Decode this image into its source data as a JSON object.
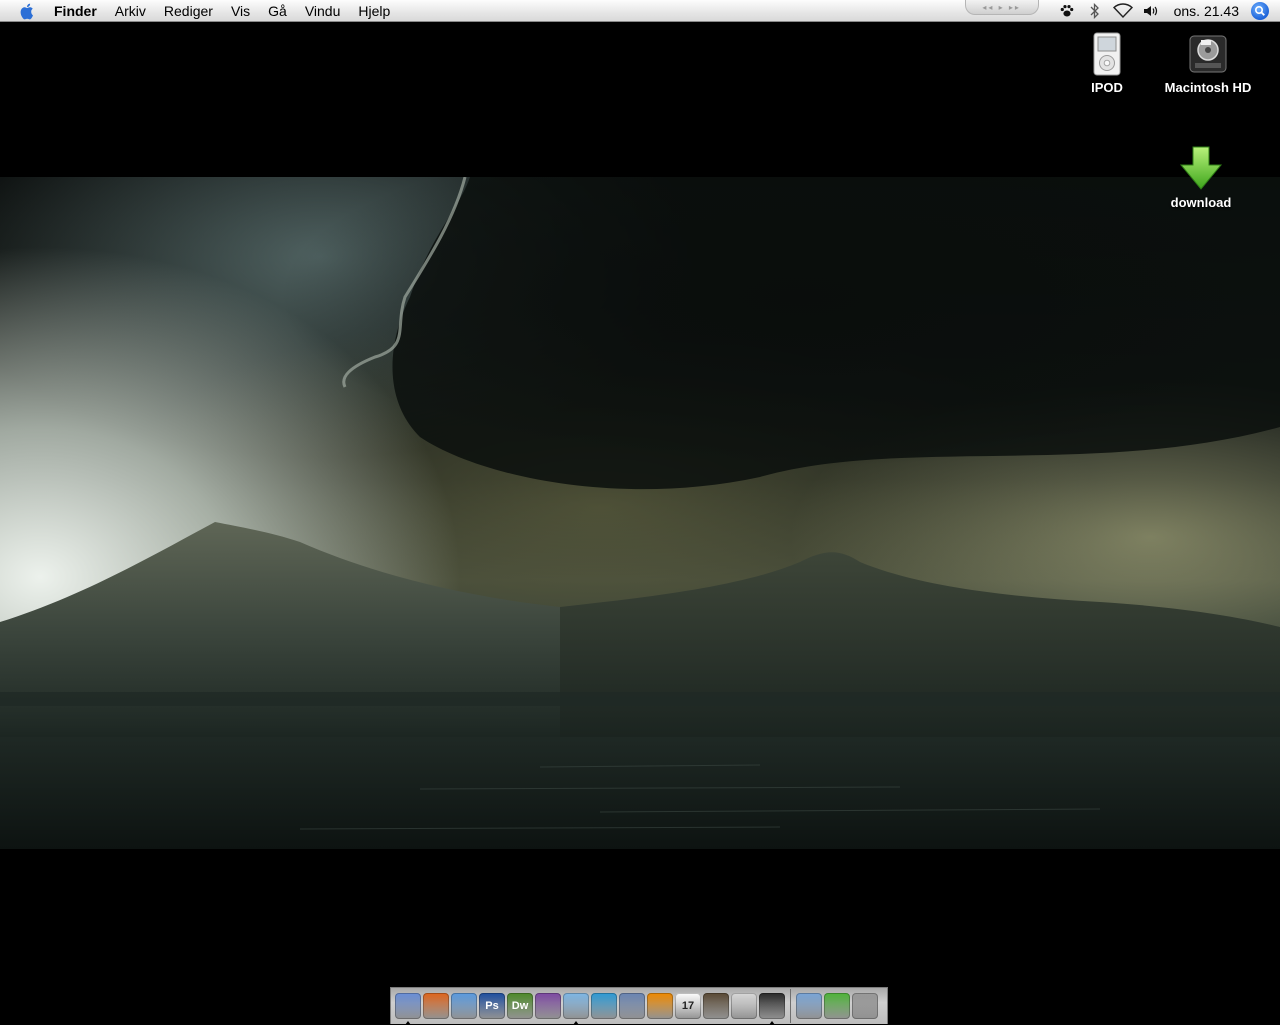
{
  "menubar": {
    "app_name": "Finder",
    "items": [
      "Arkiv",
      "Rediger",
      "Vis",
      "Gå",
      "Vindu",
      "Hjelp"
    ],
    "clock": "ons. 21.43",
    "status_icons": [
      "media-controls-icon",
      "paw-icon",
      "bluetooth-icon",
      "wifi-icon",
      "volume-icon",
      "spotlight-icon"
    ]
  },
  "desktop": {
    "icons": [
      {
        "label": "IPOD",
        "icon": "ipod-icon"
      },
      {
        "label": "Macintosh HD",
        "icon": "hard-drive-icon"
      },
      {
        "label": "download",
        "icon": "download-arrow-icon"
      }
    ]
  },
  "dock": {
    "apps": [
      {
        "name": "finder-icon",
        "color": "#6a8fd8",
        "running": true
      },
      {
        "name": "firefox-icon",
        "color": "#e0661d",
        "running": false
      },
      {
        "name": "safari-icon",
        "color": "#5b9be0",
        "running": false
      },
      {
        "name": "photoshop-icon",
        "color": "#1f4fa0",
        "text": "Ps",
        "running": false
      },
      {
        "name": "dreamweaver-icon",
        "color": "#4e8a2a",
        "text": "Dw",
        "running": false
      },
      {
        "name": "preview-icon",
        "color": "#7e4aa3",
        "running": false
      },
      {
        "name": "itunes-icon",
        "color": "#7fb8e6",
        "running": true
      },
      {
        "name": "messenger-icon",
        "color": "#2f9bd6",
        "running": false
      },
      {
        "name": "mail-icon",
        "color": "#6b86b4",
        "running": false
      },
      {
        "name": "vlc-icon",
        "color": "#f08a00",
        "running": false
      },
      {
        "name": "ical-icon",
        "color": "#ffffff",
        "text": "17",
        "running": false
      },
      {
        "name": "iphoto-icon",
        "color": "#5a4a35",
        "running": false
      },
      {
        "name": "apple-store-icon",
        "color": "#d9d9d9",
        "running": false
      },
      {
        "name": "dashboard-icon",
        "color": "#2a2a2a",
        "running": true
      }
    ],
    "docs": [
      {
        "name": "applications-folder-icon",
        "color": "#7aa6d8"
      },
      {
        "name": "downloads-stack-icon",
        "color": "#4fb53a"
      },
      {
        "name": "trash-icon",
        "color": "#9a9a9a"
      }
    ]
  }
}
